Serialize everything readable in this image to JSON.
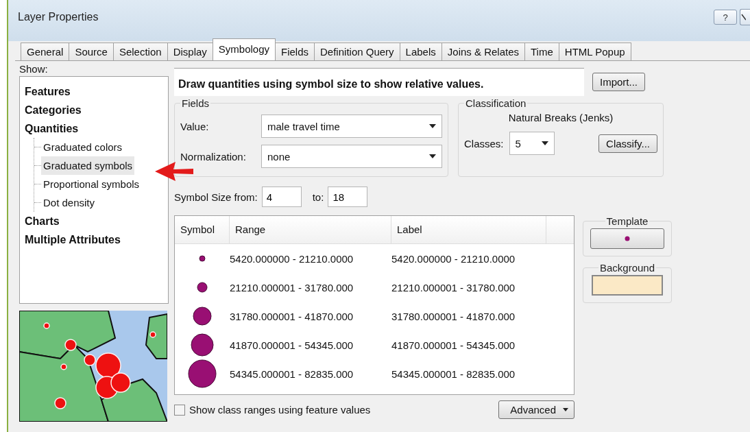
{
  "window": {
    "title": "Layer Properties",
    "help": "?"
  },
  "tabs": [
    {
      "label": "General",
      "selected": false
    },
    {
      "label": "Source",
      "selected": false
    },
    {
      "label": "Selection",
      "selected": false
    },
    {
      "label": "Display",
      "selected": false
    },
    {
      "label": "Symbology",
      "selected": true
    },
    {
      "label": "Fields",
      "selected": false
    },
    {
      "label": "Definition Query",
      "selected": false
    },
    {
      "label": "Labels",
      "selected": false
    },
    {
      "label": "Joins & Relates",
      "selected": false
    },
    {
      "label": "Time",
      "selected": false
    },
    {
      "label": "HTML Popup",
      "selected": false
    }
  ],
  "show": {
    "label": "Show:",
    "items": [
      {
        "label": "Features",
        "selected": false
      },
      {
        "label": "Categories",
        "selected": false
      },
      {
        "label": "Quantities",
        "selected": false,
        "children": [
          {
            "label": "Graduated colors",
            "selected": false
          },
          {
            "label": "Graduated symbols",
            "selected": true
          },
          {
            "label": "Proportional symbols",
            "selected": false
          },
          {
            "label": "Dot density",
            "selected": false
          }
        ]
      },
      {
        "label": "Charts",
        "selected": false
      },
      {
        "label": "Multiple Attributes",
        "selected": false
      }
    ]
  },
  "description": "Draw quantities using symbol size to show relative values.",
  "import_button": "Import...",
  "fields": {
    "title": "Fields",
    "value_label": "Value:",
    "value": "male travel time",
    "normalization_label": "Normalization:",
    "normalization": "none"
  },
  "classification": {
    "title": "Classification",
    "method": "Natural Breaks (Jenks)",
    "classes_label": "Classes:",
    "classes": "5",
    "classify_button": "Classify..."
  },
  "symbol_size": {
    "from_label": "Symbol Size from:",
    "from": "4",
    "to_label": "to:",
    "to": "18"
  },
  "table": {
    "columns": [
      "Symbol",
      "Range",
      "Label"
    ],
    "rows": [
      {
        "kind": "xs",
        "range": "5420.000000 - 21210.0000",
        "label": "5420.000000 - 21210.0000"
      },
      {
        "kind": "s",
        "range": "21210.000001 - 31780.000",
        "label": "21210.000001 - 31780.000"
      },
      {
        "kind": "m",
        "range": "31780.000001 - 41870.000",
        "label": "31780.000001 - 41870.000"
      },
      {
        "kind": "l",
        "range": "41870.000001 - 54345.000",
        "label": "41870.000001 - 54345.000"
      },
      {
        "kind": "xl",
        "range": "54345.000001 - 82835.000",
        "label": "54345.000001 - 82835.000"
      }
    ]
  },
  "template": {
    "title": "Template"
  },
  "background": {
    "title": "Background",
    "color": "#fbe9c6"
  },
  "show_feature_values": {
    "label": "Show class ranges using feature values",
    "checked": false
  },
  "advanced_button": "Advanced"
}
